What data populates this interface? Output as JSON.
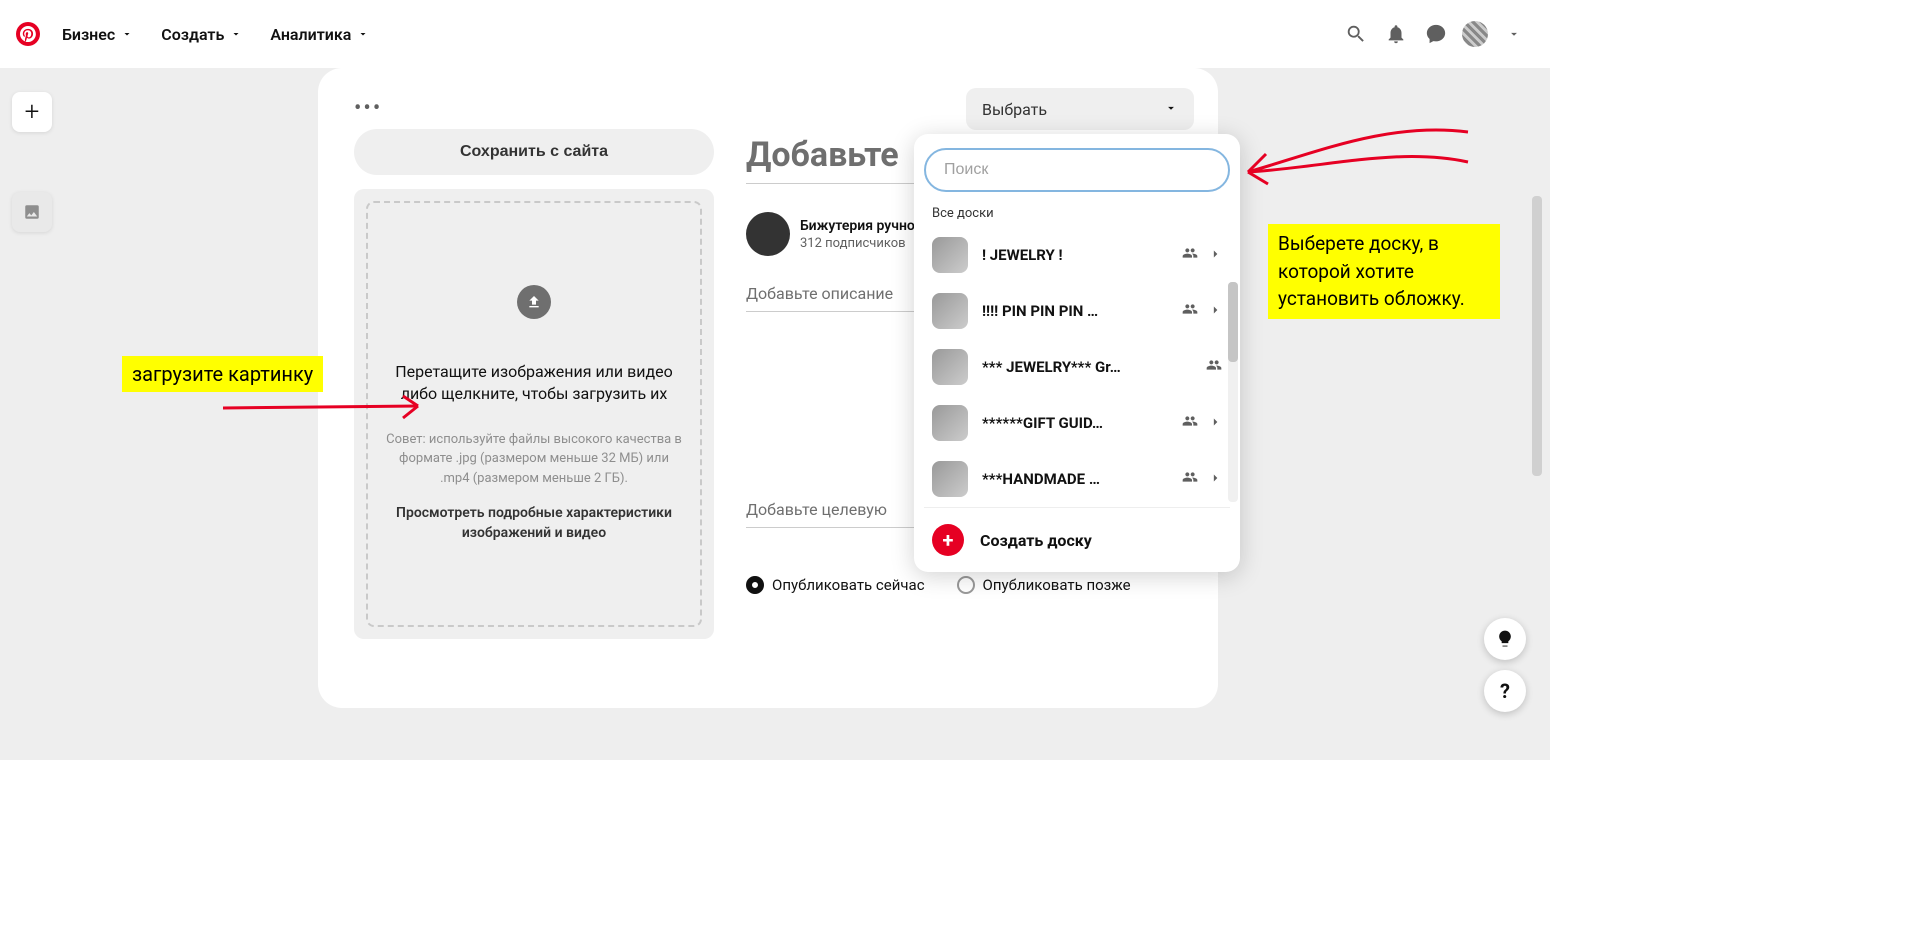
{
  "header": {
    "nav": {
      "business": "Бизнес",
      "create": "Создать",
      "analytics": "Аналитика"
    }
  },
  "rail": {
    "add": "+"
  },
  "card": {
    "save_from_site": "Сохранить с сайта",
    "upload_text": "Перетащите изображения или видео либо щелкните, чтобы загрузить их",
    "upload_hint": "Совет: используйте файлы высокого качества в формате .jpg (размером меньше 32 МБ) или .mp4 (размером меньше 2 ГБ).",
    "upload_specs": "Просмотреть подробные характеристики изображений и видео",
    "title_placeholder": "Добавьте",
    "profile_name": "Бижутерия ручной… для книг | Сережки…",
    "profile_sub": "312 подписчиков",
    "desc_placeholder": "Добавьте описание",
    "url_placeholder": "Добавьте целевую",
    "radio_now": "Опубликовать сейчас",
    "radio_later": "Опубликовать позже"
  },
  "select": {
    "label": "Выбрать"
  },
  "dropdown": {
    "search_placeholder": "Поиск",
    "section": "Все доски",
    "items": [
      {
        "label": "! JEWELRY !",
        "group": true,
        "chevron": true
      },
      {
        "label": "!!!! PIN PIN PIN …",
        "group": true,
        "chevron": true
      },
      {
        "label": "*** JEWELRY*** Gr…",
        "group": true,
        "chevron": false
      },
      {
        "label": "******GIFT GUID…",
        "group": true,
        "chevron": true
      },
      {
        "label": "***HANDMADE …",
        "group": true,
        "chevron": true
      }
    ],
    "create": "Создать доску"
  },
  "notes": {
    "n1": "загрузите картинку",
    "n2": "Выберете доску, в которой хотите установить обложку."
  }
}
